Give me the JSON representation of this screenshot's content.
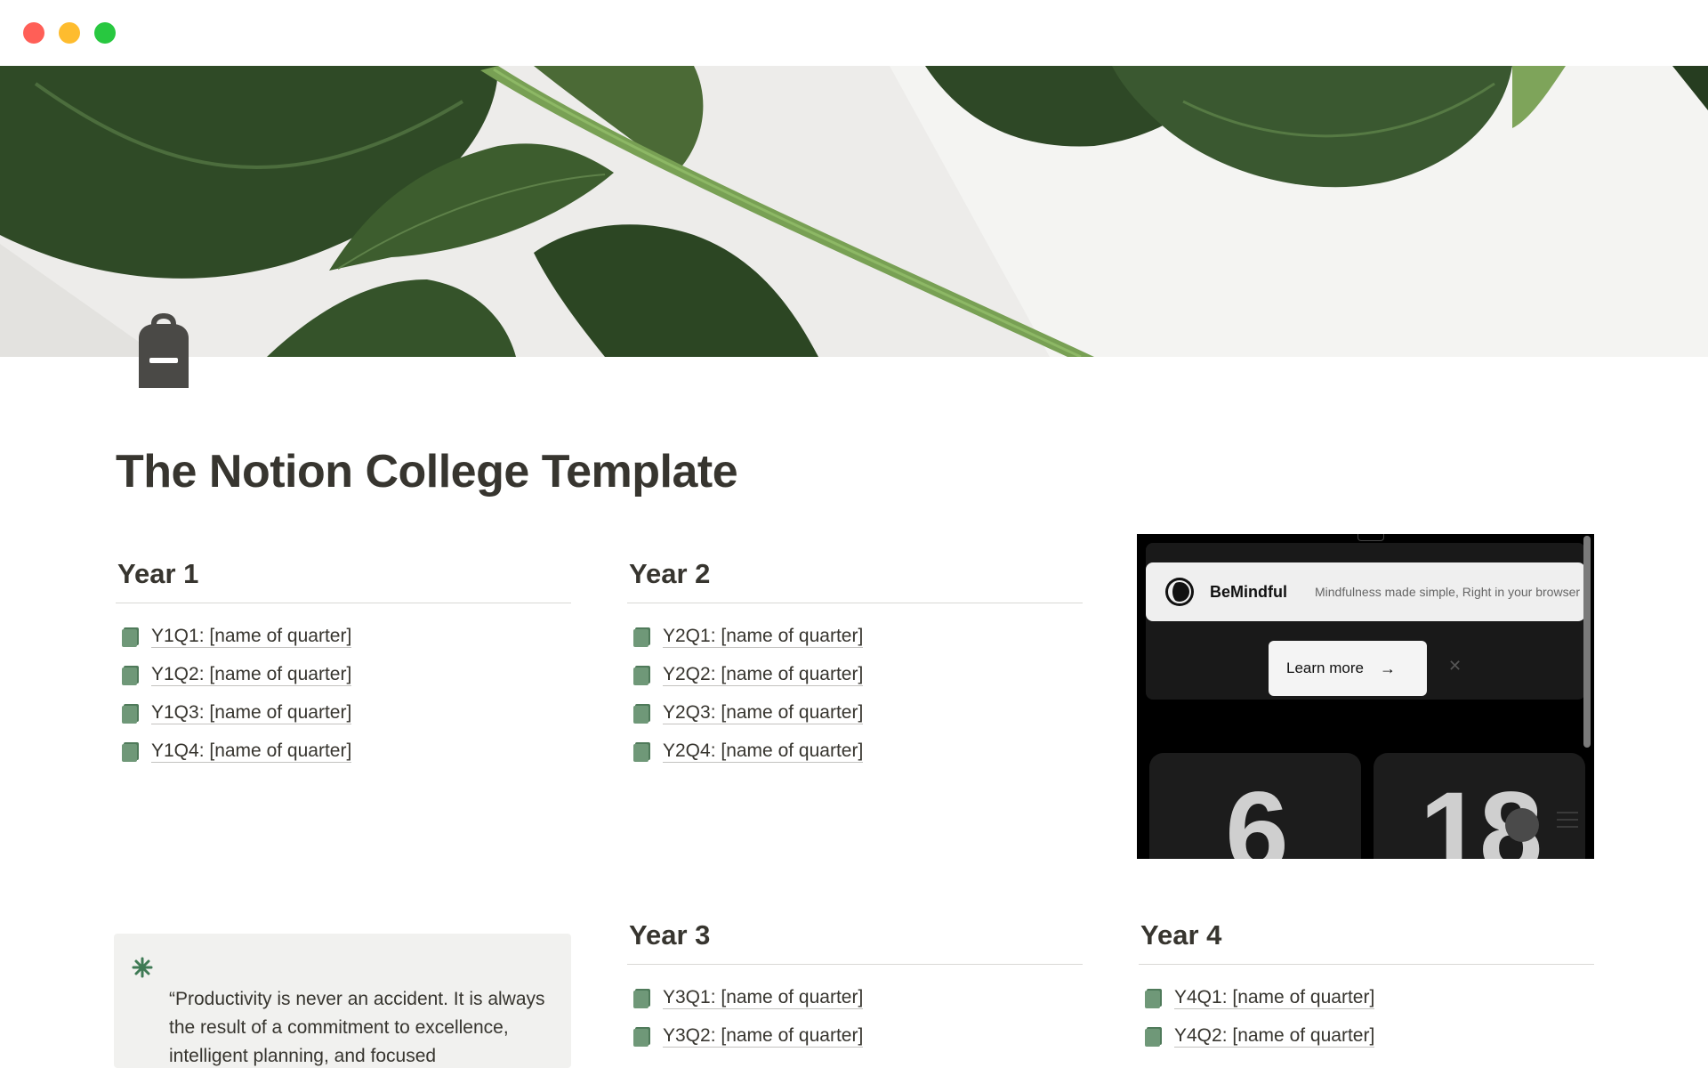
{
  "window": {
    "controls": [
      "close",
      "minimize",
      "maximize"
    ]
  },
  "page": {
    "title": "The Notion College Template",
    "icon": "backpack-icon",
    "cover": "green-leaves-cover"
  },
  "years": [
    {
      "heading": "Year 1",
      "quarters": [
        "Y1Q1: [name of quarter]",
        "Y1Q2: [name of quarter]",
        "Y1Q3: [name of quarter]",
        "Y1Q4: [name of quarter]"
      ]
    },
    {
      "heading": "Year 2",
      "quarters": [
        "Y2Q1: [name of quarter]",
        "Y2Q2: [name of quarter]",
        "Y2Q3: [name of quarter]",
        "Y2Q4: [name of quarter]"
      ]
    },
    {
      "heading": "Year 3",
      "quarters": [
        "Y3Q1: [name of quarter]",
        "Y3Q2: [name of quarter]"
      ]
    },
    {
      "heading": "Year 4",
      "quarters": [
        "Y4Q1: [name of quarter]",
        "Y4Q2: [name of quarter]"
      ]
    }
  ],
  "embed": {
    "app_name": "BeMindful",
    "tagline": "Mindfulness made simple, Right in your browser",
    "cta": "Learn more",
    "cta_icon": "arrow-right-icon",
    "dismiss_icon": "close-icon",
    "clock": {
      "hours": "6",
      "minutes": "18"
    }
  },
  "callout": {
    "icon": "asterisk-icon",
    "text": "“Productivity is never an accident. It is always the result of a commitment to excellence, intelligent planning, and focused"
  },
  "colors": {
    "title_text": "#37352f",
    "doc_icon": "#4f7a5a",
    "callout_bg": "#f1f1ef",
    "embed_bg": "#000000",
    "close": "#ff5f57",
    "minimize": "#febc2e",
    "maximize": "#28c840"
  }
}
